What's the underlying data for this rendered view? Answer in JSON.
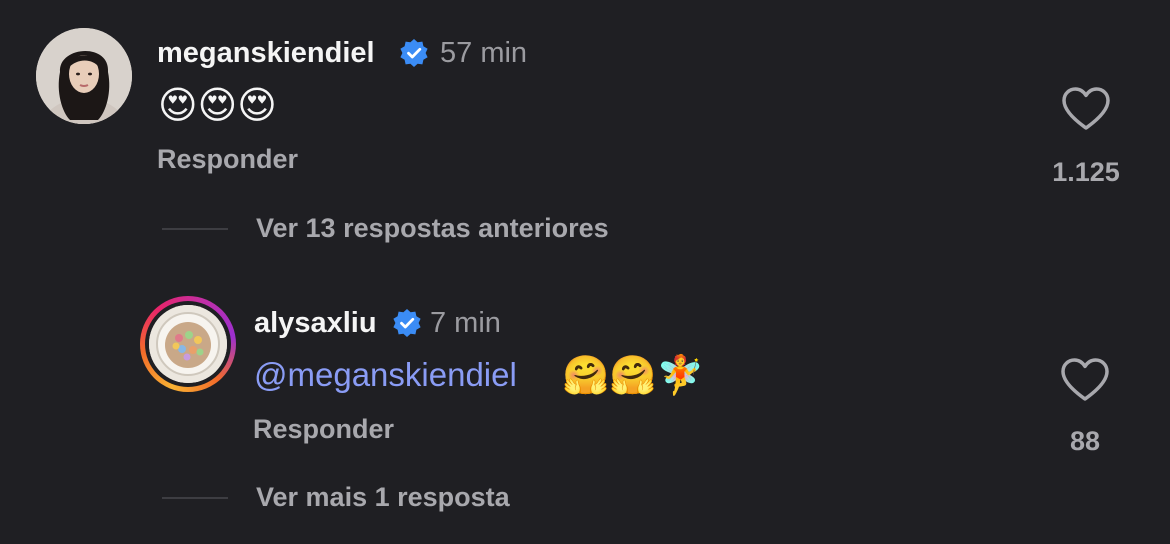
{
  "comments": [
    {
      "username": "meganskiendiel",
      "timestamp": "57 min",
      "verified": true,
      "text_emojis": "😍😍😍",
      "reply_label": "Responder",
      "likes": "1.125",
      "icons": [
        "verified-badge-icon",
        "heart-outline-icon"
      ]
    }
  ],
  "thread_toggle_prev": "Ver 13 respostas anteriores",
  "reply": {
    "username": "alysaxliu",
    "timestamp": "7 min",
    "verified": true,
    "mention": "@meganskiendiel",
    "text_emojis": "🤗🤗🧚",
    "reply_label": "Responder",
    "likes": "88"
  },
  "thread_toggle_more": "Ver mais 1 resposta",
  "colors": {
    "background": "#1f1f23",
    "primary_text": "#f5f5f5",
    "secondary_text": "#a8a8ad",
    "mention": "#8a9cf5",
    "verified": "#3b8cf5"
  }
}
